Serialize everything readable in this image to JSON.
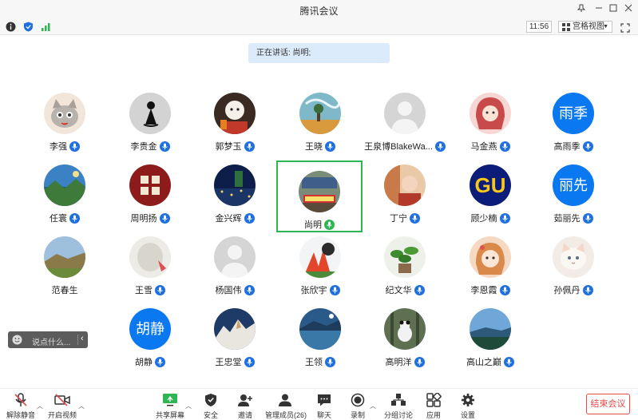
{
  "window": {
    "title": "腾讯会议"
  },
  "infobar": {
    "timer": "11:56",
    "view_label": "宫格视图"
  },
  "speaking": "正在讲话: 尚明;",
  "participants": [
    {
      "name": "李强"
    },
    {
      "name": "李贵金"
    },
    {
      "name": "郭梦玉"
    },
    {
      "name": "王晓"
    },
    {
      "name": "王泉博BlakeWa..."
    },
    {
      "name": "马金燕"
    },
    {
      "name": "高雨季",
      "avatar_text": "雨季"
    },
    {
      "name": "任寰"
    },
    {
      "name": "周明扬"
    },
    {
      "name": "金兴辉"
    },
    {
      "name": "尚明"
    },
    {
      "name": "丁宁"
    },
    {
      "name": "顾少楠",
      "avatar_text": "GU"
    },
    {
      "name": "茹丽先",
      "avatar_text": "丽先"
    },
    {
      "name": "范春生"
    },
    {
      "name": "王雪"
    },
    {
      "name": "杨国伟"
    },
    {
      "name": "张欣宇"
    },
    {
      "name": "纪文华"
    },
    {
      "name": "李恩霞"
    },
    {
      "name": "孙佩丹"
    },
    {
      "name": "胡静",
      "avatar_text": "胡静"
    },
    {
      "name": "王忠堂"
    },
    {
      "name": "王领"
    },
    {
      "name": "高明洋"
    },
    {
      "name": "高山之巅"
    }
  ],
  "chat": {
    "placeholder": "说点什么..."
  },
  "toolbar": {
    "unmute": "解除静音",
    "video": "开启视频",
    "share": "共享屏幕",
    "security": "安全",
    "invite": "邀请",
    "members": "管理成员(26)",
    "chat": "聊天",
    "record": "录制",
    "breakout": "分组讨论",
    "apps": "应用",
    "settings": "设置",
    "end": "结束会议"
  },
  "colors": {
    "accent": "#1e6fe0",
    "active": "#2fb552",
    "end": "#e24a4a"
  }
}
